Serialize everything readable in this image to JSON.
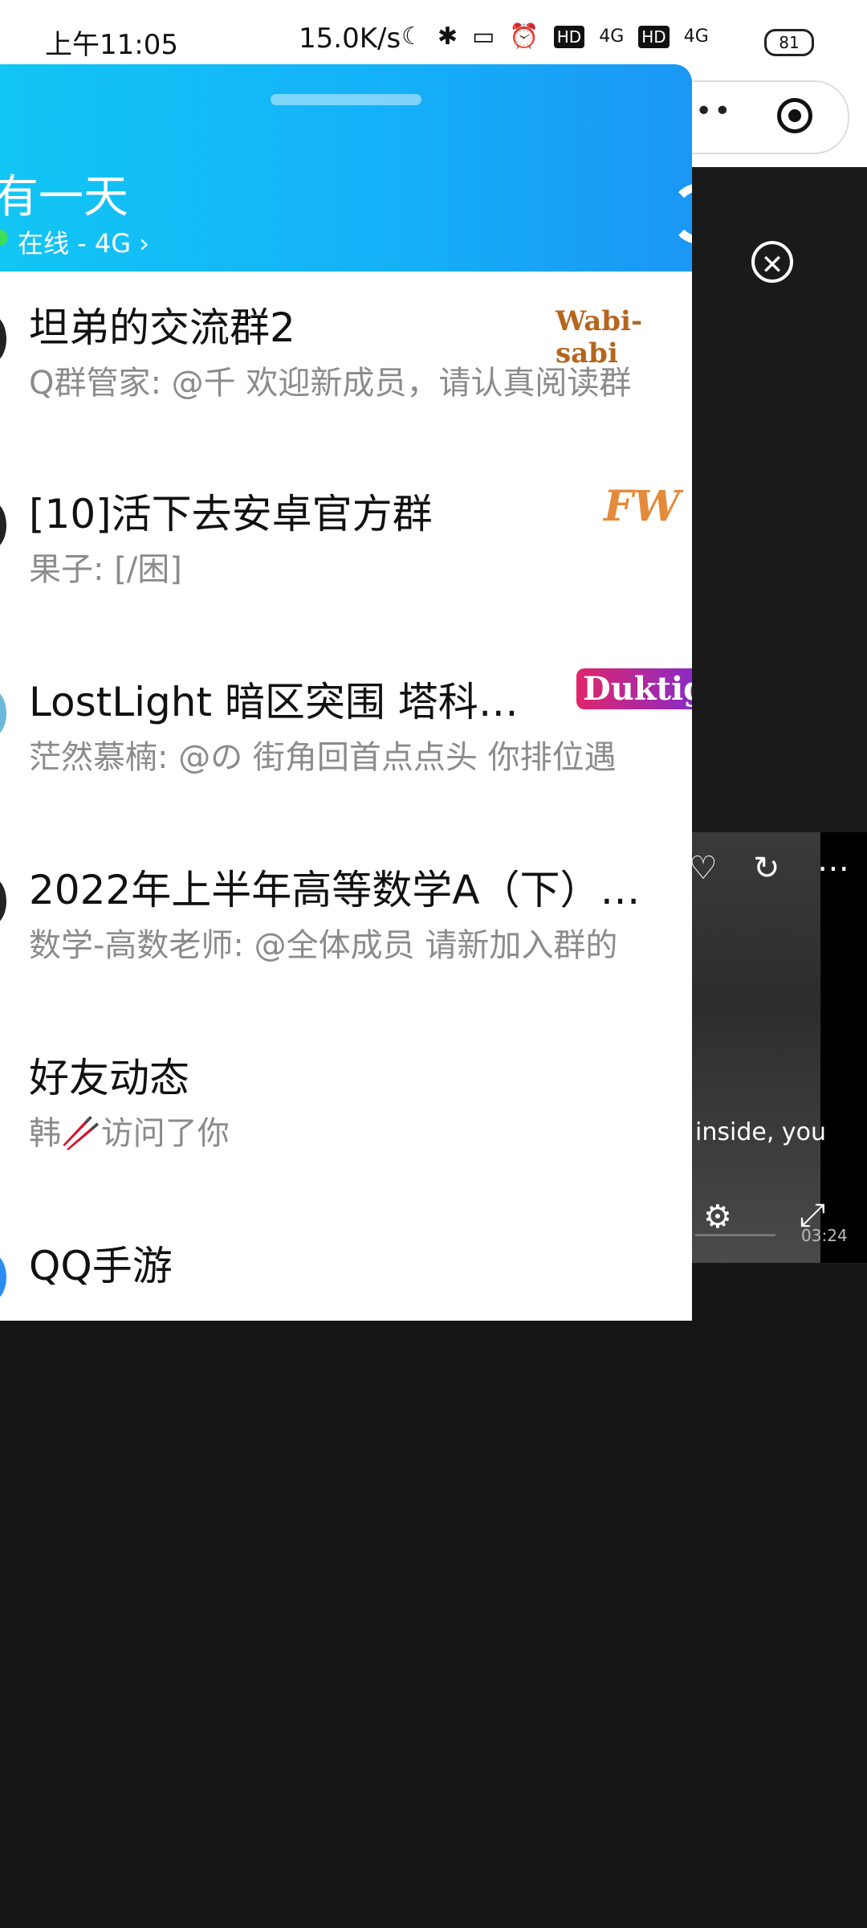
{
  "status_bar": {
    "time": "上午11:05",
    "net_speed": "15.0K/s",
    "network1": "4G",
    "network2": "4G",
    "battery": "81"
  },
  "drawer": {
    "profile_name": "有一天",
    "status": "在线 - 4G",
    "status_chevron": "›"
  },
  "chats": [
    {
      "title": "坦弟的交流群2",
      "subtitle": "Q群管家: @千 欢迎新成员，请认真阅读群",
      "badge": "Wabi-sabi"
    },
    {
      "title": "[10]活下去安卓官方群",
      "subtitle": "果子: [/困]",
      "badge": "FW"
    },
    {
      "title": "LostLight 暗区突围 塔科…",
      "subtitle": "茫然慕楠: @の 街角回首点点头 你排位遇",
      "badge": "Duktig"
    },
    {
      "title": "2022年上半年高等数学A（下）…",
      "subtitle": "数学-高数老师: @全体成员 请新加入群的",
      "badge": ""
    },
    {
      "title": "好友动态",
      "subtitle": "韩🥢访问了你",
      "badge": ""
    },
    {
      "title": "QQ手游",
      "subtitle": "",
      "badge": ""
    }
  ],
  "background_app": {
    "caption": "inside, you",
    "video_time": "03:24"
  }
}
